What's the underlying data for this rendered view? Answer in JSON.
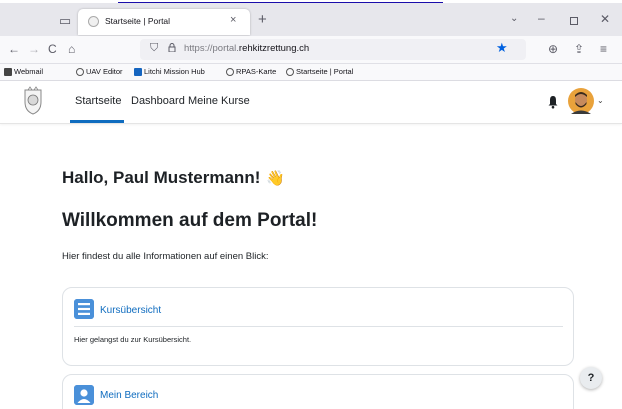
{
  "browser": {
    "tab": {
      "title": "Startseite | Portal",
      "close": "×"
    },
    "new_tab": "+",
    "tab_list": "⌄",
    "window": {
      "minimize": "–",
      "close": "✕"
    },
    "nav": {
      "back": "←",
      "forward": "→",
      "reload": "C",
      "home": "⌂"
    },
    "url": {
      "prefix": "https://portal.",
      "domain": "rehkitzrettung.ch"
    },
    "bookmarks": [
      {
        "label": "Webmail",
        "icon": "mail-icon"
      },
      {
        "label": "UAV Editor",
        "icon": "globe-icon"
      },
      {
        "label": "Litchi Mission Hub",
        "icon": "litchi-icon"
      },
      {
        "label": "RPAS-Karte",
        "icon": "globe-icon"
      },
      {
        "label": "Startseite | Portal",
        "icon": "globe-icon"
      }
    ],
    "toolbar_right": {
      "account": "⊕",
      "share": "⇪",
      "menu": "≡"
    }
  },
  "site": {
    "nav": [
      "Startseite",
      "Dashboard",
      "Meine Kurse"
    ],
    "active_nav": "Startseite",
    "accent_color": "#0f6cbf"
  },
  "main": {
    "greeting": "Hallo, Paul Mustermann!",
    "wave_emoji": "👋",
    "welcome": "Willkommen auf dem Portal!",
    "intro": "Hier findest du alle Informationen auf einen Blick:",
    "cards": [
      {
        "title": "Kursübersicht",
        "description": "Hier gelangst du zur Kursübersicht.",
        "icon": "list-icon"
      },
      {
        "title": "Mein Bereich",
        "icon": "user-icon"
      }
    ]
  },
  "help": {
    "label": "?"
  }
}
